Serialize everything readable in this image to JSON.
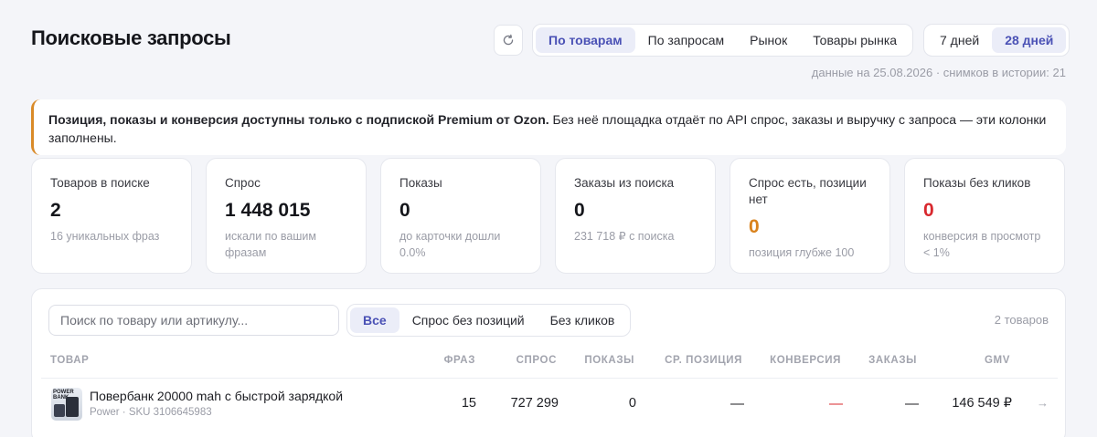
{
  "header": {
    "title": "Поисковые запросы",
    "view_tabs": [
      {
        "label": "По товарам",
        "active": true
      },
      {
        "label": "По запросам",
        "active": false
      },
      {
        "label": "Рынок",
        "active": false
      },
      {
        "label": "Товары рынка",
        "active": false
      }
    ],
    "period_tabs": [
      {
        "label": "7 дней",
        "active": false
      },
      {
        "label": "28 дней",
        "active": true
      }
    ],
    "meta": "данные на 25.08.2026 · снимков в истории: 21"
  },
  "notice": {
    "bold": "Позиция, показы и конверсия доступны только с подпиской Premium от Ozon.",
    "text": " Без неё площадка отдаёт по API спрос, заказы и выручку с запроса — эти колонки заполнены."
  },
  "cards": [
    {
      "label": "Товаров в поиске",
      "value": "2",
      "sub": "16 уникальных фраз",
      "tone": "default"
    },
    {
      "label": "Спрос",
      "value": "1 448 015",
      "sub": "искали по вашим фразам",
      "tone": "default"
    },
    {
      "label": "Показы",
      "value": "0",
      "sub": "до карточки дошли 0.0%",
      "tone": "default"
    },
    {
      "label": "Заказы из поиска",
      "value": "0",
      "sub": "231 718 ₽ с поиска",
      "tone": "default"
    },
    {
      "label": "Спрос есть, позиции нет",
      "value": "0",
      "sub": "позиция глубже 100",
      "tone": "orange"
    },
    {
      "label": "Показы без кликов",
      "value": "0",
      "sub": "конверсия в просмотр < 1%",
      "tone": "red"
    }
  ],
  "table": {
    "search_placeholder": "Поиск по товару или артикулу...",
    "filters": [
      {
        "label": "Все",
        "active": true
      },
      {
        "label": "Спрос без позиций",
        "active": false
      },
      {
        "label": "Без кликов",
        "active": false
      }
    ],
    "count": "2 товаров",
    "columns": [
      "ТОВАР",
      "ФРАЗ",
      "СПРОС",
      "ПОКАЗЫ",
      "СР. ПОЗИЦИЯ",
      "КОНВЕРСИЯ",
      "ЗАКАЗЫ",
      "GMV"
    ],
    "rows": [
      {
        "name": "Повербанк 20000 mah с быстрой зарядкой",
        "sub": "Power · SKU 3106645983",
        "thumb_text": "POWER BANK",
        "phrases": "15",
        "demand": "727 299",
        "impressions": "0",
        "avg_position": "—",
        "conversion": "—",
        "orders": "—",
        "gmv": "146 549 ₽"
      }
    ]
  },
  "colors": {
    "accent": "#4a51b5",
    "accent_bg": "#ebedf8",
    "warning": "#d9821c",
    "danger": "#d8282e",
    "notice_border": "#d98a28"
  },
  "icons": {
    "refresh": "refresh-icon",
    "row_arrow": "arrow-right-icon"
  }
}
